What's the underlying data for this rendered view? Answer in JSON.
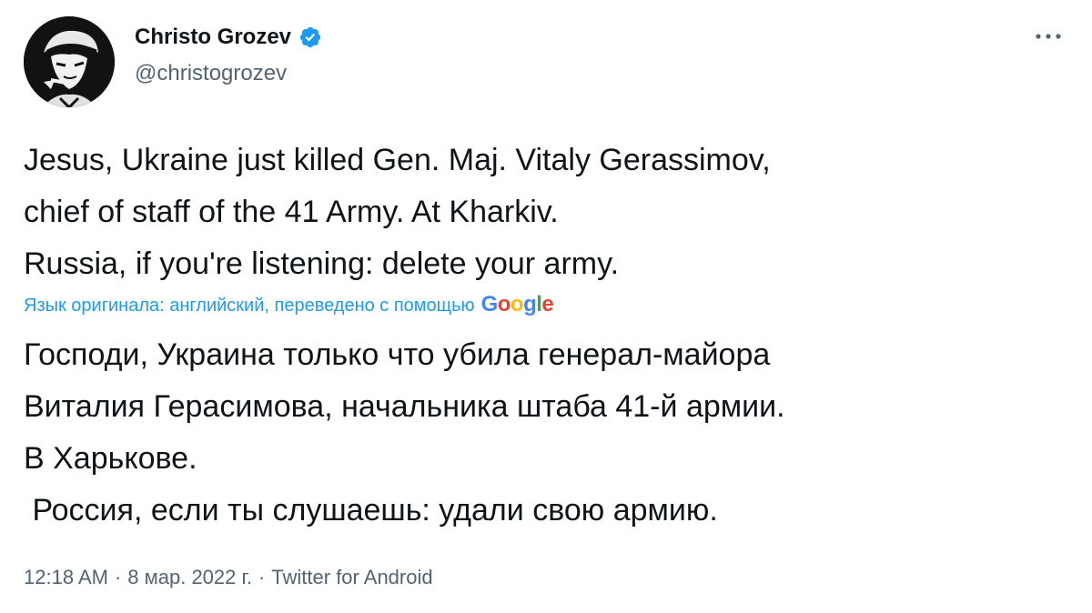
{
  "author": {
    "display_name": "Christo Grozev",
    "handle": "@christogrozev",
    "verified": true
  },
  "tweet": {
    "text": "Jesus, Ukraine just killed Gen. Maj. Vitaly Gerassimov,\nchief of staff of the 41 Army. At Kharkiv.\nRussia, if you're listening: delete your army.",
    "translation_note": "Язык оригинала: английский, переведено с помощью",
    "translation_provider": "Google",
    "translated_text": "Господи, Украина только что убила генерал-майора\nВиталия Герасимова, начальника штаба 41-й армии.\nВ Харькове.\n Россия, если ты слушаешь: удали свою армию."
  },
  "meta": {
    "time": "12:18 AM",
    "separator": "·",
    "date": "8 мар. 2022 г.",
    "source": "Twitter for Android"
  },
  "icons": {
    "avatar": "profile-photo",
    "verified": "verified-badge-icon",
    "more": "more-options-icon"
  },
  "colors": {
    "text": "#0f1419",
    "secondary": "#536471",
    "accent": "#1d9bf0"
  }
}
